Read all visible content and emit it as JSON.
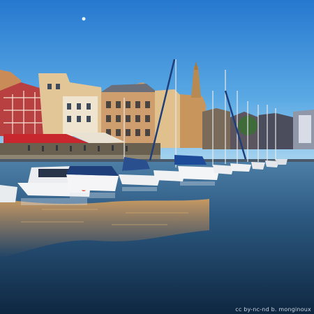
{
  "photo": {
    "credit": "cc by-nc-nd    b. monginoux"
  },
  "colors": {
    "sky_top": "#2f86d6",
    "sky_bottom": "#9fd0ef",
    "water_top": "#3b6e98",
    "water_bottom": "#0d2740",
    "building_warm": "#d9a46a",
    "timber_red": "#b43a3a",
    "awning_red": "#c8282d"
  }
}
